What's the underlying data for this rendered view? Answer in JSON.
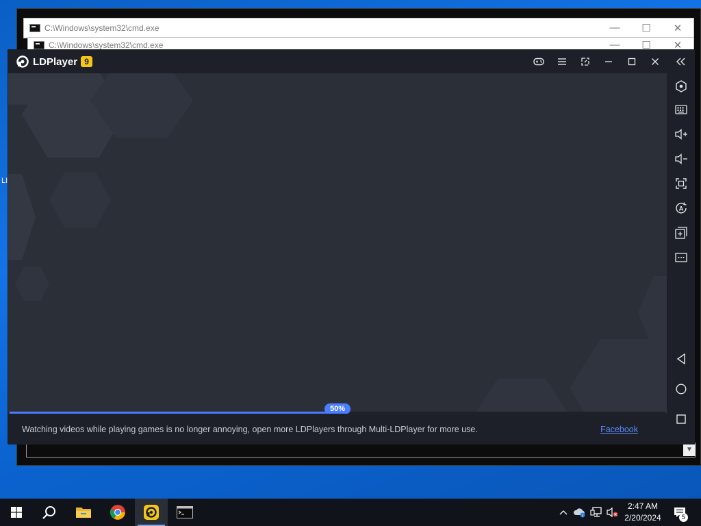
{
  "desktop": {
    "side_label": "LI"
  },
  "cmd_windows": [
    {
      "title": "C:\\Windows\\system32\\cmd.exe"
    },
    {
      "title": "C:\\Windows\\system32\\cmd.exe"
    }
  ],
  "cmd_controls": {
    "minimize": "—",
    "maximize": "☐",
    "close": "✕",
    "scroll_down": "▼"
  },
  "ldplayer": {
    "app_name": "LDPlayer",
    "version_badge": "9",
    "progress": {
      "value": 0.5,
      "label": "50%"
    },
    "tip_text": "Watching videos while playing games is no longer annoying, open more LDPlayers through Multi-LDPlayer for more use.",
    "link_text": "Facebook",
    "accent_color": "#4a7dff",
    "badge_color": "#f5c518",
    "titlebar_icons": [
      "gamepad-icon",
      "menu-icon",
      "popout-icon",
      "minimize-icon",
      "maximize-icon",
      "close-icon"
    ],
    "sidebar_icons": [
      "collapse-icon",
      "settings-icon",
      "keyboard-icon",
      "volume-up-icon",
      "volume-down-icon",
      "fullscreen-icon",
      "operation-record-icon",
      "multi-instance-add-icon",
      "more-icon",
      "back-icon",
      "home-icon",
      "recents-icon"
    ]
  },
  "taskbar": {
    "time": "2:47 AM",
    "date": "2/20/2024",
    "notification_count": "5",
    "apps": [
      "start-icon",
      "search-icon",
      "file-explorer-icon",
      "chrome-icon",
      "ldplayer-icon",
      "cmd-icon"
    ]
  }
}
